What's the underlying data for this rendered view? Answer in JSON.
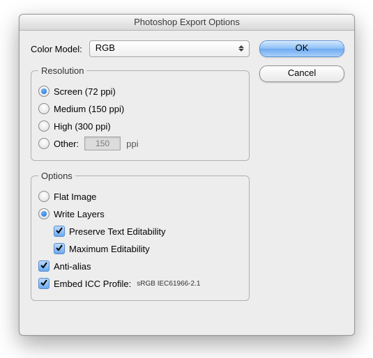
{
  "window": {
    "title": "Photoshop Export Options"
  },
  "buttons": {
    "ok": "OK",
    "cancel": "Cancel"
  },
  "colorModel": {
    "label": "Color Model:",
    "value": "RGB"
  },
  "resolution": {
    "legend": "Resolution",
    "screen": {
      "label": "Screen (72 ppi)",
      "selected": true
    },
    "medium": {
      "label": "Medium (150 ppi)",
      "selected": false
    },
    "high": {
      "label": "High (300 ppi)",
      "selected": false
    },
    "other": {
      "label": "Other:",
      "selected": false,
      "value": "150",
      "unit": "ppi"
    }
  },
  "options": {
    "legend": "Options",
    "flat": {
      "label": "Flat Image",
      "selected": false
    },
    "writeLayers": {
      "label": "Write Layers",
      "selected": true
    },
    "preserveText": {
      "label": "Preserve Text Editability",
      "checked": true
    },
    "maxEdit": {
      "label": "Maximum Editability",
      "checked": true
    },
    "antiAlias": {
      "label": "Anti-alias",
      "checked": true
    },
    "embedICC": {
      "label": "Embed ICC Profile:",
      "checked": true,
      "profile": "sRGB IEC61966-2.1"
    }
  }
}
